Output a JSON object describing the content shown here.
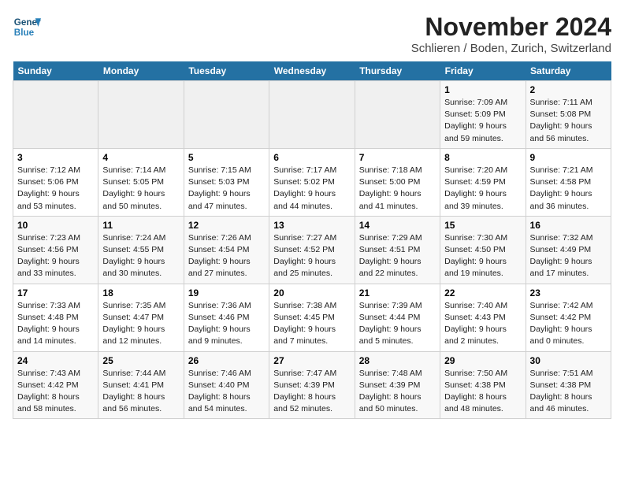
{
  "logo": {
    "line1": "General",
    "line2": "Blue"
  },
  "title": "November 2024",
  "location": "Schlieren / Boden, Zurich, Switzerland",
  "weekdays": [
    "Sunday",
    "Monday",
    "Tuesday",
    "Wednesday",
    "Thursday",
    "Friday",
    "Saturday"
  ],
  "weeks": [
    [
      {
        "day": "",
        "info": ""
      },
      {
        "day": "",
        "info": ""
      },
      {
        "day": "",
        "info": ""
      },
      {
        "day": "",
        "info": ""
      },
      {
        "day": "",
        "info": ""
      },
      {
        "day": "1",
        "info": "Sunrise: 7:09 AM\nSunset: 5:09 PM\nDaylight: 9 hours and 59 minutes."
      },
      {
        "day": "2",
        "info": "Sunrise: 7:11 AM\nSunset: 5:08 PM\nDaylight: 9 hours and 56 minutes."
      }
    ],
    [
      {
        "day": "3",
        "info": "Sunrise: 7:12 AM\nSunset: 5:06 PM\nDaylight: 9 hours and 53 minutes."
      },
      {
        "day": "4",
        "info": "Sunrise: 7:14 AM\nSunset: 5:05 PM\nDaylight: 9 hours and 50 minutes."
      },
      {
        "day": "5",
        "info": "Sunrise: 7:15 AM\nSunset: 5:03 PM\nDaylight: 9 hours and 47 minutes."
      },
      {
        "day": "6",
        "info": "Sunrise: 7:17 AM\nSunset: 5:02 PM\nDaylight: 9 hours and 44 minutes."
      },
      {
        "day": "7",
        "info": "Sunrise: 7:18 AM\nSunset: 5:00 PM\nDaylight: 9 hours and 41 minutes."
      },
      {
        "day": "8",
        "info": "Sunrise: 7:20 AM\nSunset: 4:59 PM\nDaylight: 9 hours and 39 minutes."
      },
      {
        "day": "9",
        "info": "Sunrise: 7:21 AM\nSunset: 4:58 PM\nDaylight: 9 hours and 36 minutes."
      }
    ],
    [
      {
        "day": "10",
        "info": "Sunrise: 7:23 AM\nSunset: 4:56 PM\nDaylight: 9 hours and 33 minutes."
      },
      {
        "day": "11",
        "info": "Sunrise: 7:24 AM\nSunset: 4:55 PM\nDaylight: 9 hours and 30 minutes."
      },
      {
        "day": "12",
        "info": "Sunrise: 7:26 AM\nSunset: 4:54 PM\nDaylight: 9 hours and 27 minutes."
      },
      {
        "day": "13",
        "info": "Sunrise: 7:27 AM\nSunset: 4:52 PM\nDaylight: 9 hours and 25 minutes."
      },
      {
        "day": "14",
        "info": "Sunrise: 7:29 AM\nSunset: 4:51 PM\nDaylight: 9 hours and 22 minutes."
      },
      {
        "day": "15",
        "info": "Sunrise: 7:30 AM\nSunset: 4:50 PM\nDaylight: 9 hours and 19 minutes."
      },
      {
        "day": "16",
        "info": "Sunrise: 7:32 AM\nSunset: 4:49 PM\nDaylight: 9 hours and 17 minutes."
      }
    ],
    [
      {
        "day": "17",
        "info": "Sunrise: 7:33 AM\nSunset: 4:48 PM\nDaylight: 9 hours and 14 minutes."
      },
      {
        "day": "18",
        "info": "Sunrise: 7:35 AM\nSunset: 4:47 PM\nDaylight: 9 hours and 12 minutes."
      },
      {
        "day": "19",
        "info": "Sunrise: 7:36 AM\nSunset: 4:46 PM\nDaylight: 9 hours and 9 minutes."
      },
      {
        "day": "20",
        "info": "Sunrise: 7:38 AM\nSunset: 4:45 PM\nDaylight: 9 hours and 7 minutes."
      },
      {
        "day": "21",
        "info": "Sunrise: 7:39 AM\nSunset: 4:44 PM\nDaylight: 9 hours and 5 minutes."
      },
      {
        "day": "22",
        "info": "Sunrise: 7:40 AM\nSunset: 4:43 PM\nDaylight: 9 hours and 2 minutes."
      },
      {
        "day": "23",
        "info": "Sunrise: 7:42 AM\nSunset: 4:42 PM\nDaylight: 9 hours and 0 minutes."
      }
    ],
    [
      {
        "day": "24",
        "info": "Sunrise: 7:43 AM\nSunset: 4:42 PM\nDaylight: 8 hours and 58 minutes."
      },
      {
        "day": "25",
        "info": "Sunrise: 7:44 AM\nSunset: 4:41 PM\nDaylight: 8 hours and 56 minutes."
      },
      {
        "day": "26",
        "info": "Sunrise: 7:46 AM\nSunset: 4:40 PM\nDaylight: 8 hours and 54 minutes."
      },
      {
        "day": "27",
        "info": "Sunrise: 7:47 AM\nSunset: 4:39 PM\nDaylight: 8 hours and 52 minutes."
      },
      {
        "day": "28",
        "info": "Sunrise: 7:48 AM\nSunset: 4:39 PM\nDaylight: 8 hours and 50 minutes."
      },
      {
        "day": "29",
        "info": "Sunrise: 7:50 AM\nSunset: 4:38 PM\nDaylight: 8 hours and 48 minutes."
      },
      {
        "day": "30",
        "info": "Sunrise: 7:51 AM\nSunset: 4:38 PM\nDaylight: 8 hours and 46 minutes."
      }
    ]
  ]
}
